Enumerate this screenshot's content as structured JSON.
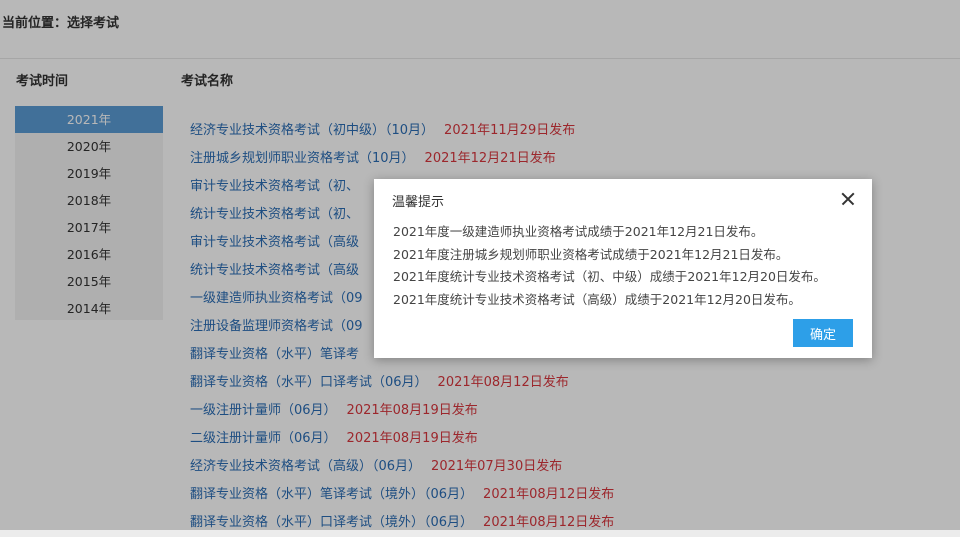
{
  "breadcrumb": "当前位置：选择考试",
  "headers": {
    "time": "考试时间",
    "name": "考试名称"
  },
  "years": [
    "2021年",
    "2020年",
    "2019年",
    "2018年",
    "2017年",
    "2016年",
    "2015年",
    "2014年"
  ],
  "selected_year": "2021年",
  "exams": [
    {
      "name": "经济专业技术资格考试（初中级）（10月）",
      "date": "2021年11月29日发布"
    },
    {
      "name": "注册城乡规划师职业资格考试（10月）",
      "date": "2021年12月21日发布"
    },
    {
      "name": "审计专业技术资格考试（初、",
      "date": ""
    },
    {
      "name": "统计专业技术资格考试（初、",
      "date": ""
    },
    {
      "name": "审计专业技术资格考试（高级",
      "date": ""
    },
    {
      "name": "统计专业技术资格考试（高级",
      "date": ""
    },
    {
      "name": "一级建造师执业资格考试（09",
      "date": ""
    },
    {
      "name": "注册设备监理师资格考试（09",
      "date": ""
    },
    {
      "name": "翻译专业资格（水平）笔译考",
      "date": ""
    },
    {
      "name": "翻译专业资格（水平）口译考试（06月）",
      "date": "2021年08月12日发布"
    },
    {
      "name": "一级注册计量师（06月）",
      "date": "2021年08月19日发布"
    },
    {
      "name": "二级注册计量师（06月）",
      "date": "2021年08月19日发布"
    },
    {
      "name": "经济专业技术资格考试（高级）（06月）",
      "date": "2021年07月30日发布"
    },
    {
      "name": "翻译专业资格（水平）笔译考试（境外）（06月）",
      "date": "2021年08月12日发布"
    },
    {
      "name": "翻译专业资格（水平）口译考试（境外）（06月）",
      "date": "2021年08月12日发布"
    }
  ],
  "modal": {
    "title": "温馨提示",
    "messages": [
      "2021年度一级建造师执业资格考试成绩于2021年12月21日发布。",
      "2021年度注册城乡规划师职业资格考试成绩于2021年12月21日发布。",
      "2021年度统计专业技术资格考试（初、中级）成绩于2021年12月20日发布。",
      "2021年度统计专业技术资格考试（高级）成绩于2021年12月20日发布。"
    ],
    "confirm_label": "确定"
  },
  "colors": {
    "link": "#2a6db5",
    "date": "#d9363e",
    "active_year": "#5b9bd5",
    "button": "#2d9fe8"
  }
}
